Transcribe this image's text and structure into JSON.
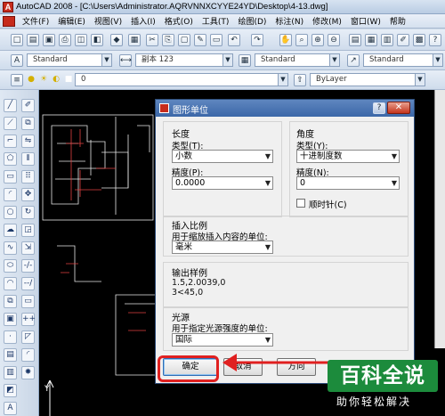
{
  "titlebar": {
    "title": "AutoCAD 2008 - [C:\\Users\\Administrator.AQRVNNXCYYE24YD\\Desktop\\4-13.dwg]"
  },
  "menubar": {
    "items": [
      "文件(F)",
      "编辑(E)",
      "视图(V)",
      "插入(I)",
      "格式(O)",
      "工具(T)",
      "绘图(D)",
      "标注(N)",
      "修改(M)",
      "窗口(W)",
      "帮助"
    ]
  },
  "toolbar2": {
    "text_style": "Standard",
    "dim_style": "副本 123",
    "table_style": "Standard",
    "multileader_style": "Standard"
  },
  "toolbar3": {
    "layer": "0",
    "color": "ByLayer"
  },
  "dialog": {
    "title": "图形单位",
    "help": "?",
    "close": "✕",
    "length": {
      "section": "长度",
      "type_label": "类型(T):",
      "type_value": "小数",
      "precision_label": "精度(P):",
      "precision_value": "0.0000"
    },
    "angle": {
      "section": "角度",
      "type_label": "类型(Y):",
      "type_value": "十进制度数",
      "precision_label": "精度(N):",
      "precision_value": "0",
      "clockwise_label": "顺时针(C)",
      "clockwise_checked": false
    },
    "insert_scale": {
      "section": "插入比例",
      "label": "用于缩放插入内容的单位:",
      "value": "毫米"
    },
    "sample": {
      "section": "输出样例",
      "line1": "1.5,2.0039,0",
      "line2": "3<45,0"
    },
    "lighting": {
      "section": "光源",
      "label": "用于指定光源强度的单位:",
      "value": "国际"
    },
    "buttons": {
      "ok": "确定",
      "cancel": "取消",
      "direction": "方向"
    }
  },
  "watermark": {
    "main": "百科全说",
    "sub": "助你轻松解决"
  },
  "icons": [
    "new-icon",
    "open-icon",
    "save-icon",
    "print-icon",
    "cut-icon",
    "copy-icon",
    "paste-icon",
    "undo-icon",
    "redo-icon",
    "pan-icon",
    "zoom-icon",
    "line-icon",
    "circle-icon",
    "arc-icon",
    "rectangle-icon",
    "move-icon",
    "rotate-icon",
    "text-icon",
    "lightbulb-icon",
    "sun-icon"
  ],
  "colors": {
    "highlight": "#e02020",
    "dialog_title": "#3b67a8",
    "watermark_bg": "#1c8b3c",
    "drawing_bg": "#000000"
  }
}
